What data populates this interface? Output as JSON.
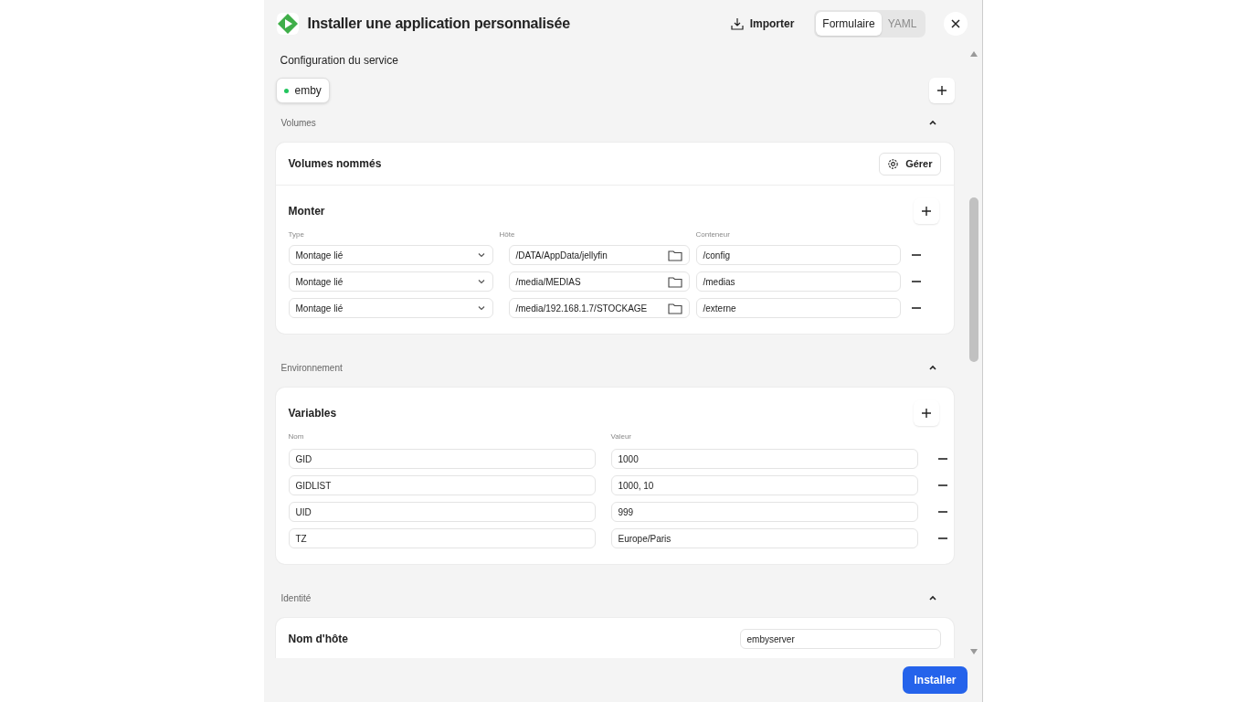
{
  "dialog": {
    "title": "Installer une application personnalisée",
    "import_label": "Importer",
    "modes": [
      {
        "label": "Formulaire",
        "selected": true
      },
      {
        "label": "YAML",
        "selected": false
      }
    ]
  },
  "section_title": "Configuration du service",
  "services": [
    {
      "name": "emby",
      "selected": true,
      "color": "#22c55e"
    }
  ],
  "volumes": {
    "title": "Volumes",
    "expanded": true,
    "named_volumes": {
      "title": "Volumes nommés",
      "manage_label": "Gérer"
    },
    "mounts": {
      "title": "Monter",
      "columns": [
        "Type",
        "Hôte",
        "Conteneur"
      ],
      "rows": [
        {
          "type": "Montage lié",
          "host": "/DATA/AppData/jellyfin",
          "container": "/config"
        },
        {
          "type": "Montage lié",
          "host": "/media/MEDIAS",
          "container": "/medias"
        },
        {
          "type": "Montage lié",
          "host": "/media/192.168.1.7/STOCKAGE",
          "container": "/externe"
        }
      ]
    }
  },
  "environment": {
    "title": "Environnement",
    "expanded": true,
    "variables": {
      "title": "Variables",
      "columns": [
        "Nom",
        "Valeur"
      ],
      "rows": [
        {
          "name": "GID",
          "value": "1000"
        },
        {
          "name": "GIDLIST",
          "value": "1000, 10"
        },
        {
          "name": "UID",
          "value": "999"
        },
        {
          "name": "TZ",
          "value": "Europe/Paris"
        }
      ]
    }
  },
  "identity": {
    "title": "Identité",
    "expanded": true,
    "hostname_label": "Nom d'hôte",
    "hostname_value": "embyserver"
  },
  "install_label": "Installer"
}
